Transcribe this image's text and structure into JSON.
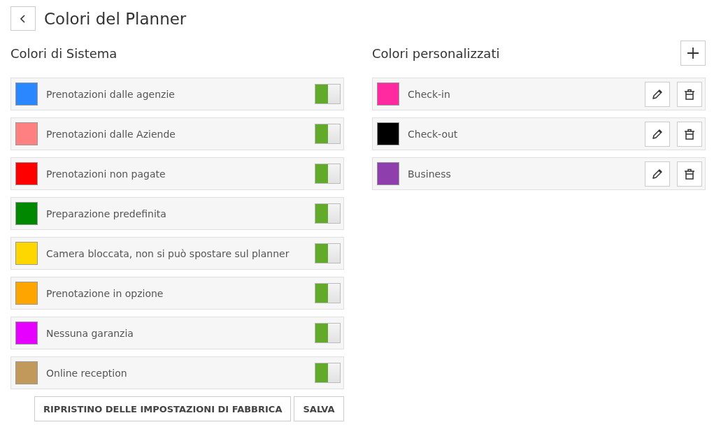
{
  "title": "Colori del Planner",
  "system": {
    "heading": "Colori di Sistema",
    "items": [
      {
        "label": "Prenotazioni dalle agenzie",
        "color": "#2b87ff",
        "on": true
      },
      {
        "label": "Prenotazioni dalle Aziende",
        "color": "#ff8080",
        "on": true
      },
      {
        "label": "Prenotazioni non pagate",
        "color": "#ff0000",
        "on": true
      },
      {
        "label": "Preparazione predefinita",
        "color": "#008800",
        "on": true
      },
      {
        "label": "Camera bloccata, non si può spostare sul planner",
        "color": "#ffd700",
        "on": true
      },
      {
        "label": "Prenotazione in opzione",
        "color": "#ffa500",
        "on": true
      },
      {
        "label": "Nessuna garanzia",
        "color": "#e600ff",
        "on": true
      },
      {
        "label": "Online reception",
        "color": "#c19a5b",
        "on": true
      }
    ]
  },
  "custom": {
    "heading": "Colori personalizzati",
    "items": [
      {
        "label": "Check-in",
        "color": "#ff2aa0"
      },
      {
        "label": "Check-out",
        "color": "#000000"
      },
      {
        "label": "Business",
        "color": "#8e3fad"
      }
    ]
  },
  "buttons": [
    "RIPRISTINO DELLE IMPOSTAZIONI DI FABBRICA",
    "SALVA"
  ]
}
